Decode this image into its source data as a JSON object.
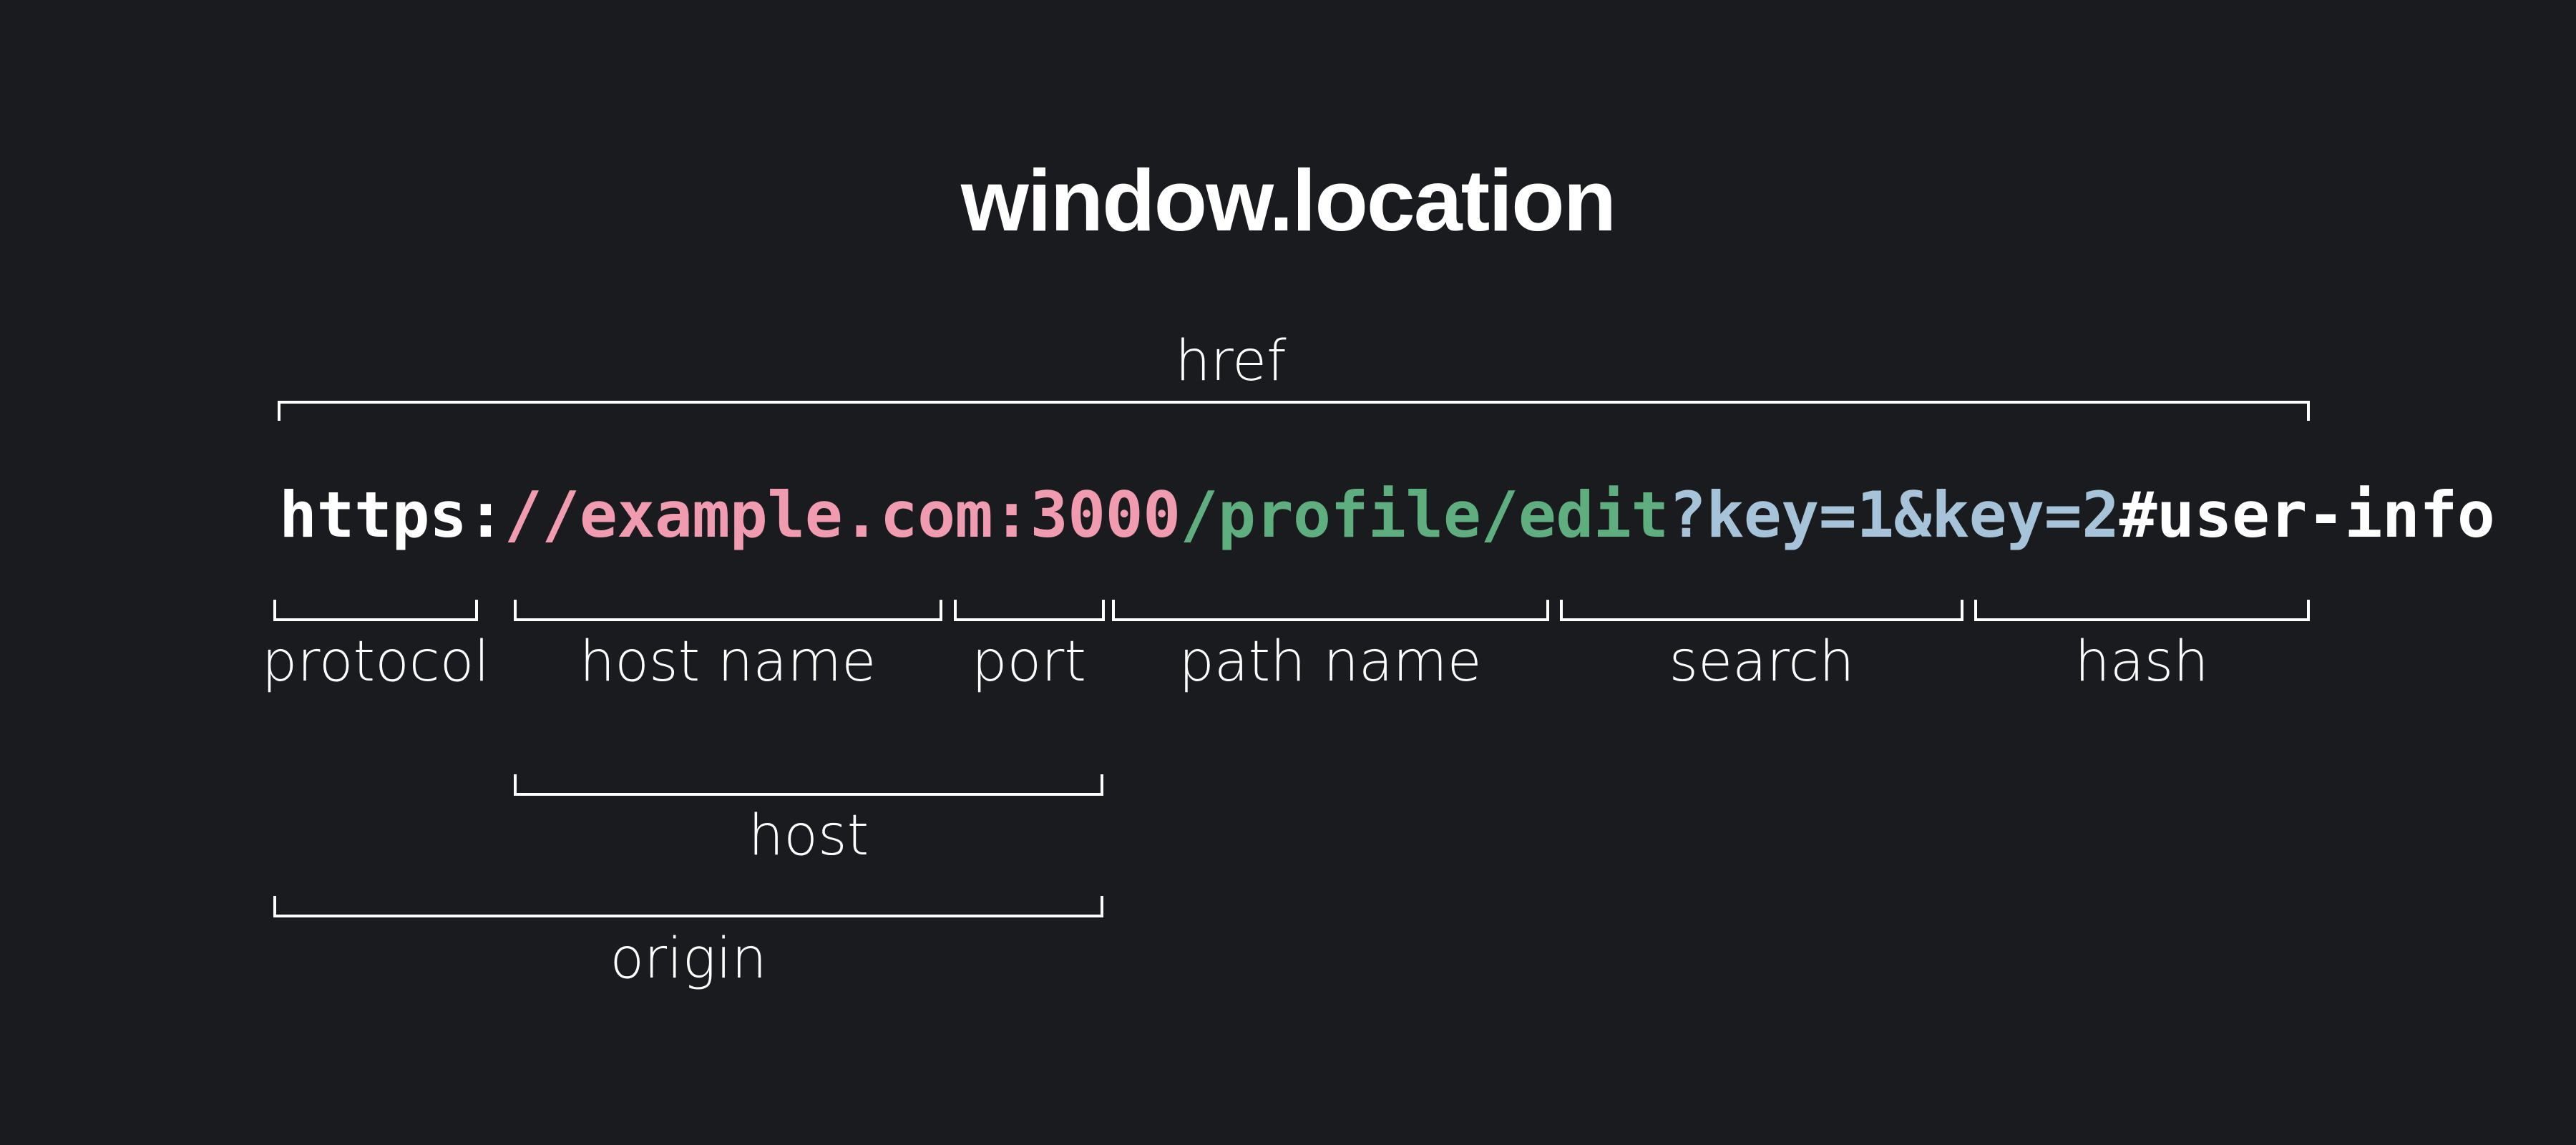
{
  "title": "window.location",
  "url": {
    "segments": [
      {
        "name": "protocol",
        "text": "https:",
        "color": "#ffffff"
      },
      {
        "name": "hostname",
        "text": "//example.com",
        "color": "#f09bb0"
      },
      {
        "name": "port",
        "text": ":3000",
        "color": "#f09bb0"
      },
      {
        "name": "pathname",
        "text": "/profile/edit",
        "color": "#5fae7f"
      },
      {
        "name": "search",
        "text": "?key=1&key=2",
        "color": "#a6c3d9"
      },
      {
        "name": "hash",
        "text": "#user-info",
        "color": "#ffffff"
      }
    ]
  },
  "labels": {
    "href": "href",
    "protocol": "protocol",
    "hostname": "host name",
    "port": "port",
    "pathname": "path name",
    "search": "search",
    "hash": "hash",
    "host": "host",
    "origin": "origin"
  }
}
